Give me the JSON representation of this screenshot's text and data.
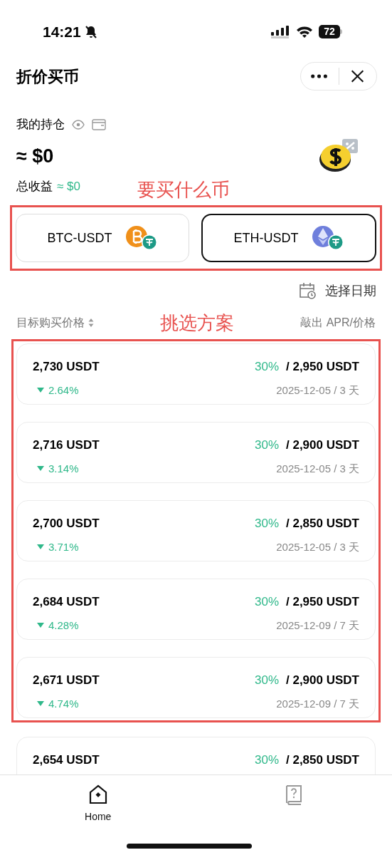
{
  "status_bar": {
    "time": "14:21",
    "battery": "72"
  },
  "header": {
    "title": "折价买币"
  },
  "holdings": {
    "label": "我的持仓",
    "value": "≈ $0",
    "earnings_label": "总收益",
    "earnings_value": "≈ $0"
  },
  "pair_annotation": "要买什么币",
  "pairs": [
    {
      "label": "BTC-USDT",
      "kind": "btc",
      "selected": false
    },
    {
      "label": "ETH-USDT",
      "kind": "eth",
      "selected": true
    }
  ],
  "date_picker": {
    "label": "选择日期"
  },
  "list_header": {
    "column_1": "目标购买价格",
    "column_2": "敲出 APR/价格"
  },
  "plan_annotation": "挑选方案",
  "annotated_plans": [
    {
      "price": "2,730 USDT",
      "apr": "30%",
      "target": "/ 2,950 USDT",
      "discount": "2.64%",
      "term": "2025-12-05 / 3 天"
    },
    {
      "price": "2,716 USDT",
      "apr": "30%",
      "target": "/ 2,900 USDT",
      "discount": "3.14%",
      "term": "2025-12-05 / 3 天"
    },
    {
      "price": "2,700 USDT",
      "apr": "30%",
      "target": "/ 2,850 USDT",
      "discount": "3.71%",
      "term": "2025-12-05 / 3 天"
    },
    {
      "price": "2,684 USDT",
      "apr": "30%",
      "target": "/ 2,950 USDT",
      "discount": "4.28%",
      "term": "2025-12-09 / 7 天"
    },
    {
      "price": "2,671 USDT",
      "apr": "30%",
      "target": "/ 2,900 USDT",
      "discount": "4.74%",
      "term": "2025-12-09 / 7 天"
    }
  ],
  "more_plans": [
    {
      "price": "2,654 USDT",
      "apr": "30%",
      "target": "/ 2,850 USDT"
    }
  ],
  "tabs": [
    {
      "label": "Home",
      "kind": "home",
      "selected": true
    },
    {
      "kind": "help",
      "selected": false
    }
  ]
}
